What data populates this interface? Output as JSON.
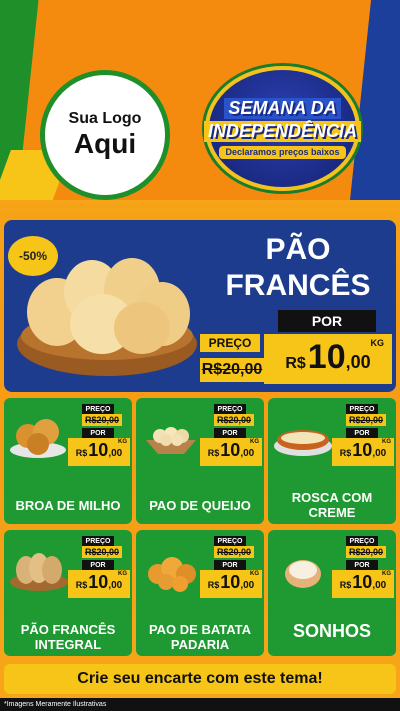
{
  "header": {
    "logo_line1": "Sua Logo",
    "logo_line2": "Aqui",
    "badge_line1": "SEMANA DA",
    "badge_line2": "INDEPENDÊNCIA",
    "badge_line3": "Declaramos preços baixos"
  },
  "main": {
    "discount": "-50%",
    "title_line1": "PÃO",
    "title_line2": "FRANCÊS",
    "price_label": "PREÇO",
    "old_price": "R$20,00",
    "por_label": "POR",
    "currency": "R$",
    "price_int": "10",
    "price_dec": ",00",
    "unit": "KG"
  },
  "products": [
    {
      "name": "BROA DE MILHO",
      "preco_label": "PREÇO",
      "old_price": "R$20,00",
      "por_label": "POR",
      "currency": "R$",
      "price_int": "10",
      "price_dec": ",00",
      "unit": "KG"
    },
    {
      "name": "PAO DE QUEIJO",
      "preco_label": "PREÇO",
      "old_price": "R$20,00",
      "por_label": "POR",
      "currency": "R$",
      "price_int": "10",
      "price_dec": ",00",
      "unit": "KG"
    },
    {
      "name": "ROSCA COM CREME",
      "preco_label": "PREÇO",
      "old_price": "R$20,00",
      "por_label": "POR",
      "currency": "R$",
      "price_int": "10",
      "price_dec": ",00",
      "unit": "KG"
    },
    {
      "name": "PÃO FRANCÊS INTEGRAL",
      "preco_label": "PREÇO",
      "old_price": "R$20,00",
      "por_label": "POR",
      "currency": "R$",
      "price_int": "10",
      "price_dec": ",00",
      "unit": "KG"
    },
    {
      "name": "PAO DE BATATA PADARIA",
      "preco_label": "PREÇO",
      "old_price": "R$20,00",
      "por_label": "POR",
      "currency": "R$",
      "price_int": "10",
      "price_dec": ",00",
      "unit": "KG"
    },
    {
      "name": "SONHOS",
      "preco_label": "PREÇO",
      "old_price": "R$20,00",
      "por_label": "POR",
      "currency": "R$",
      "price_int": "10",
      "price_dec": ",00",
      "unit": "KG"
    }
  ],
  "cta": "Crie seu encarte com este tema!",
  "footer": "*Imagens Meramente Ilustrativas",
  "colors": {
    "green": "#1f9a32",
    "blue": "#1e3c8e",
    "yellow": "#f7c517",
    "orange": "#f48b0f"
  }
}
